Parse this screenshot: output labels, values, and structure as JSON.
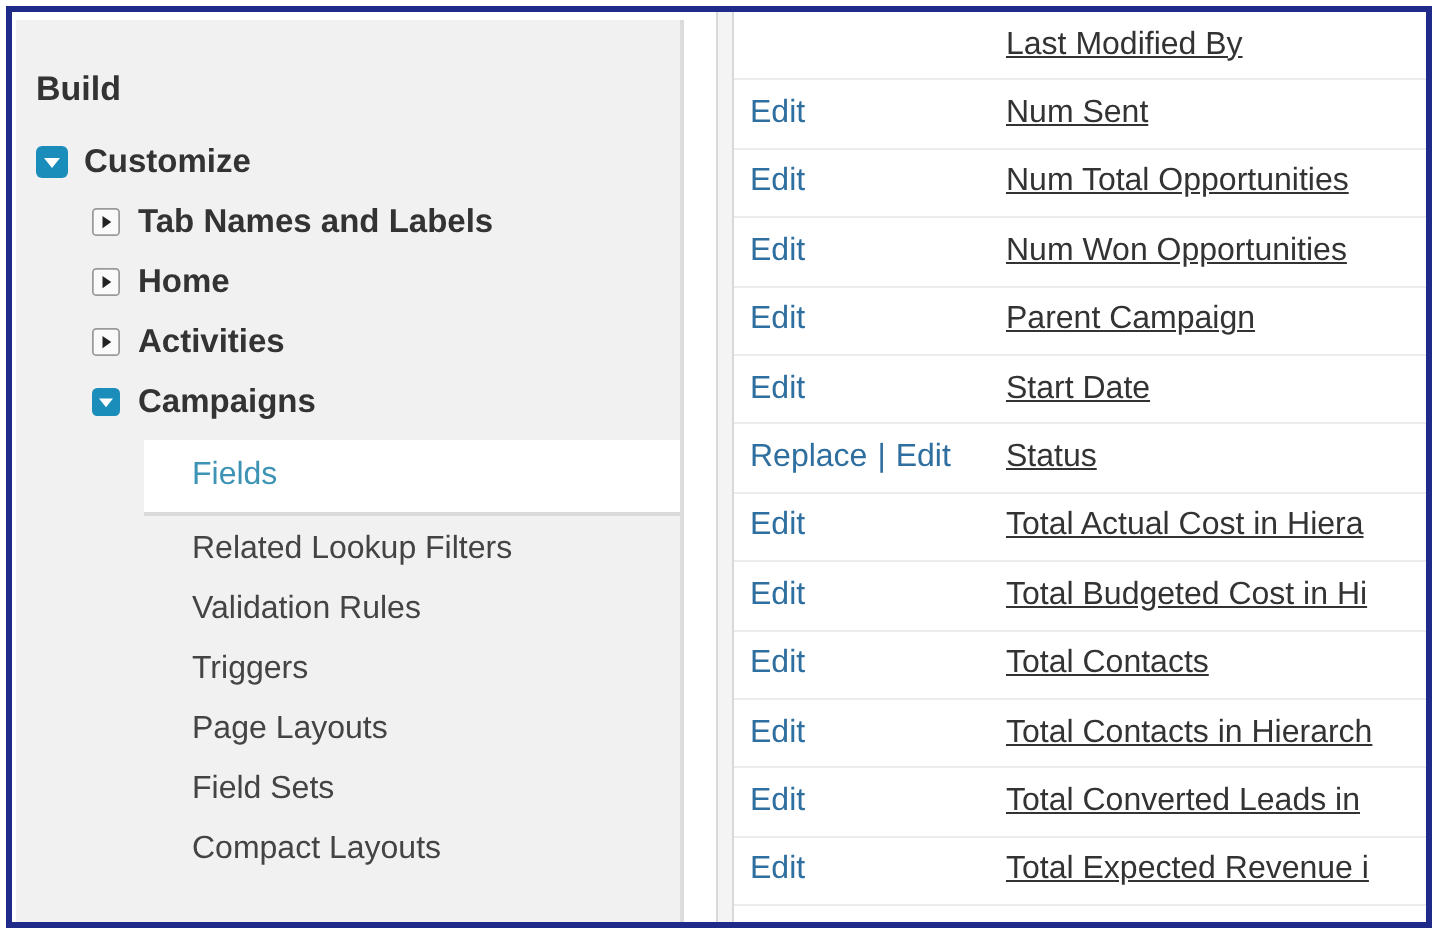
{
  "sidebar": {
    "heading": "Build",
    "tree": [
      {
        "label": "Customize",
        "expanded": true,
        "children": [
          {
            "label": "Tab Names and Labels",
            "expanded": false
          },
          {
            "label": "Home",
            "expanded": false
          },
          {
            "label": "Activities",
            "expanded": false
          },
          {
            "label": "Campaigns",
            "expanded": true,
            "children": [
              {
                "label": "Fields",
                "selected": true
              },
              {
                "label": "Related Lookup Filters",
                "selected": false
              },
              {
                "label": "Validation Rules",
                "selected": false
              },
              {
                "label": "Triggers",
                "selected": false
              },
              {
                "label": "Page Layouts",
                "selected": false
              },
              {
                "label": "Field Sets",
                "selected": false
              },
              {
                "label": "Compact Layouts",
                "selected": false
              }
            ]
          }
        ]
      }
    ]
  },
  "table": {
    "rows": [
      {
        "actions": [],
        "field": "Last Modified By"
      },
      {
        "actions": [
          "Edit"
        ],
        "field": "Num Sent"
      },
      {
        "actions": [
          "Edit"
        ],
        "field": "Num Total Opportunities"
      },
      {
        "actions": [
          "Edit"
        ],
        "field": "Num Won Opportunities"
      },
      {
        "actions": [
          "Edit"
        ],
        "field": "Parent Campaign"
      },
      {
        "actions": [
          "Edit"
        ],
        "field": "Start Date"
      },
      {
        "actions": [
          "Replace",
          "|",
          "Edit"
        ],
        "field": "Status"
      },
      {
        "actions": [
          "Edit"
        ],
        "field": "Total Actual Cost in Hiera"
      },
      {
        "actions": [
          "Edit"
        ],
        "field": "Total Budgeted Cost in Hi"
      },
      {
        "actions": [
          "Edit"
        ],
        "field": "Total Contacts"
      },
      {
        "actions": [
          "Edit"
        ],
        "field": "Total Contacts in Hierarch"
      },
      {
        "actions": [
          "Edit"
        ],
        "field": "Total Converted Leads in"
      },
      {
        "actions": [
          "Edit"
        ],
        "field": "Total Expected Revenue i"
      }
    ]
  }
}
